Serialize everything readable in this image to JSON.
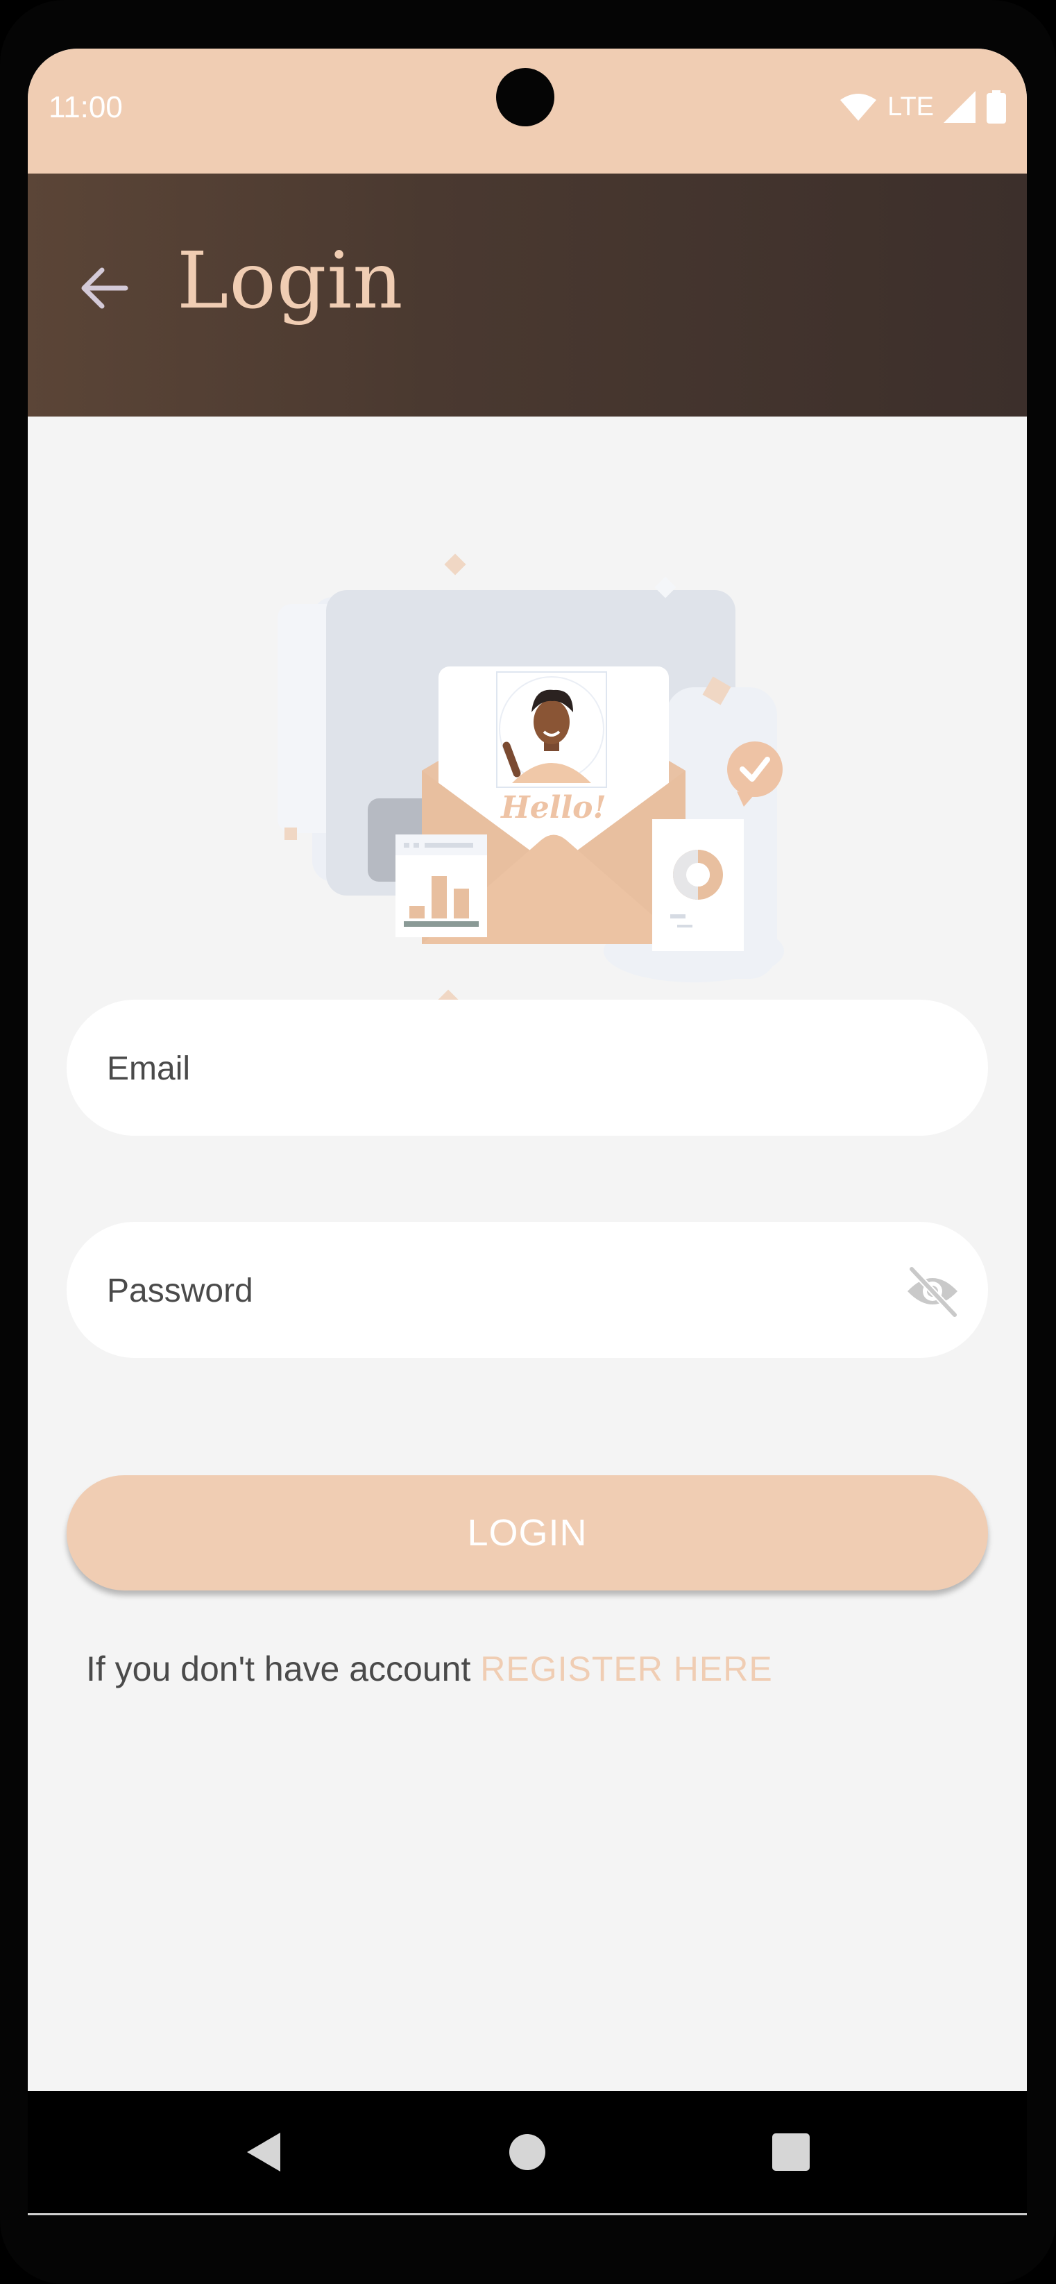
{
  "status_bar": {
    "time": "11:00",
    "network": "LTE"
  },
  "app_bar": {
    "title": "Login",
    "back_icon": "arrow-back-icon"
  },
  "illustration": {
    "greeting": "Hello!"
  },
  "form": {
    "email_placeholder": "Email",
    "password_placeholder": "Password",
    "visibility_icon": "eye-off-icon"
  },
  "login_button": {
    "label": "LOGIN"
  },
  "register": {
    "prompt": "If you don't have account",
    "link": "REGISTER HERE"
  },
  "nav_bar": {
    "back_icon": "triangle-back-icon",
    "home_icon": "circle-home-icon",
    "recents_icon": "square-recents-icon"
  },
  "colors": {
    "accent": "#f0cdb3",
    "app_bar": "#4a3930",
    "background": "#f4f4f4"
  }
}
